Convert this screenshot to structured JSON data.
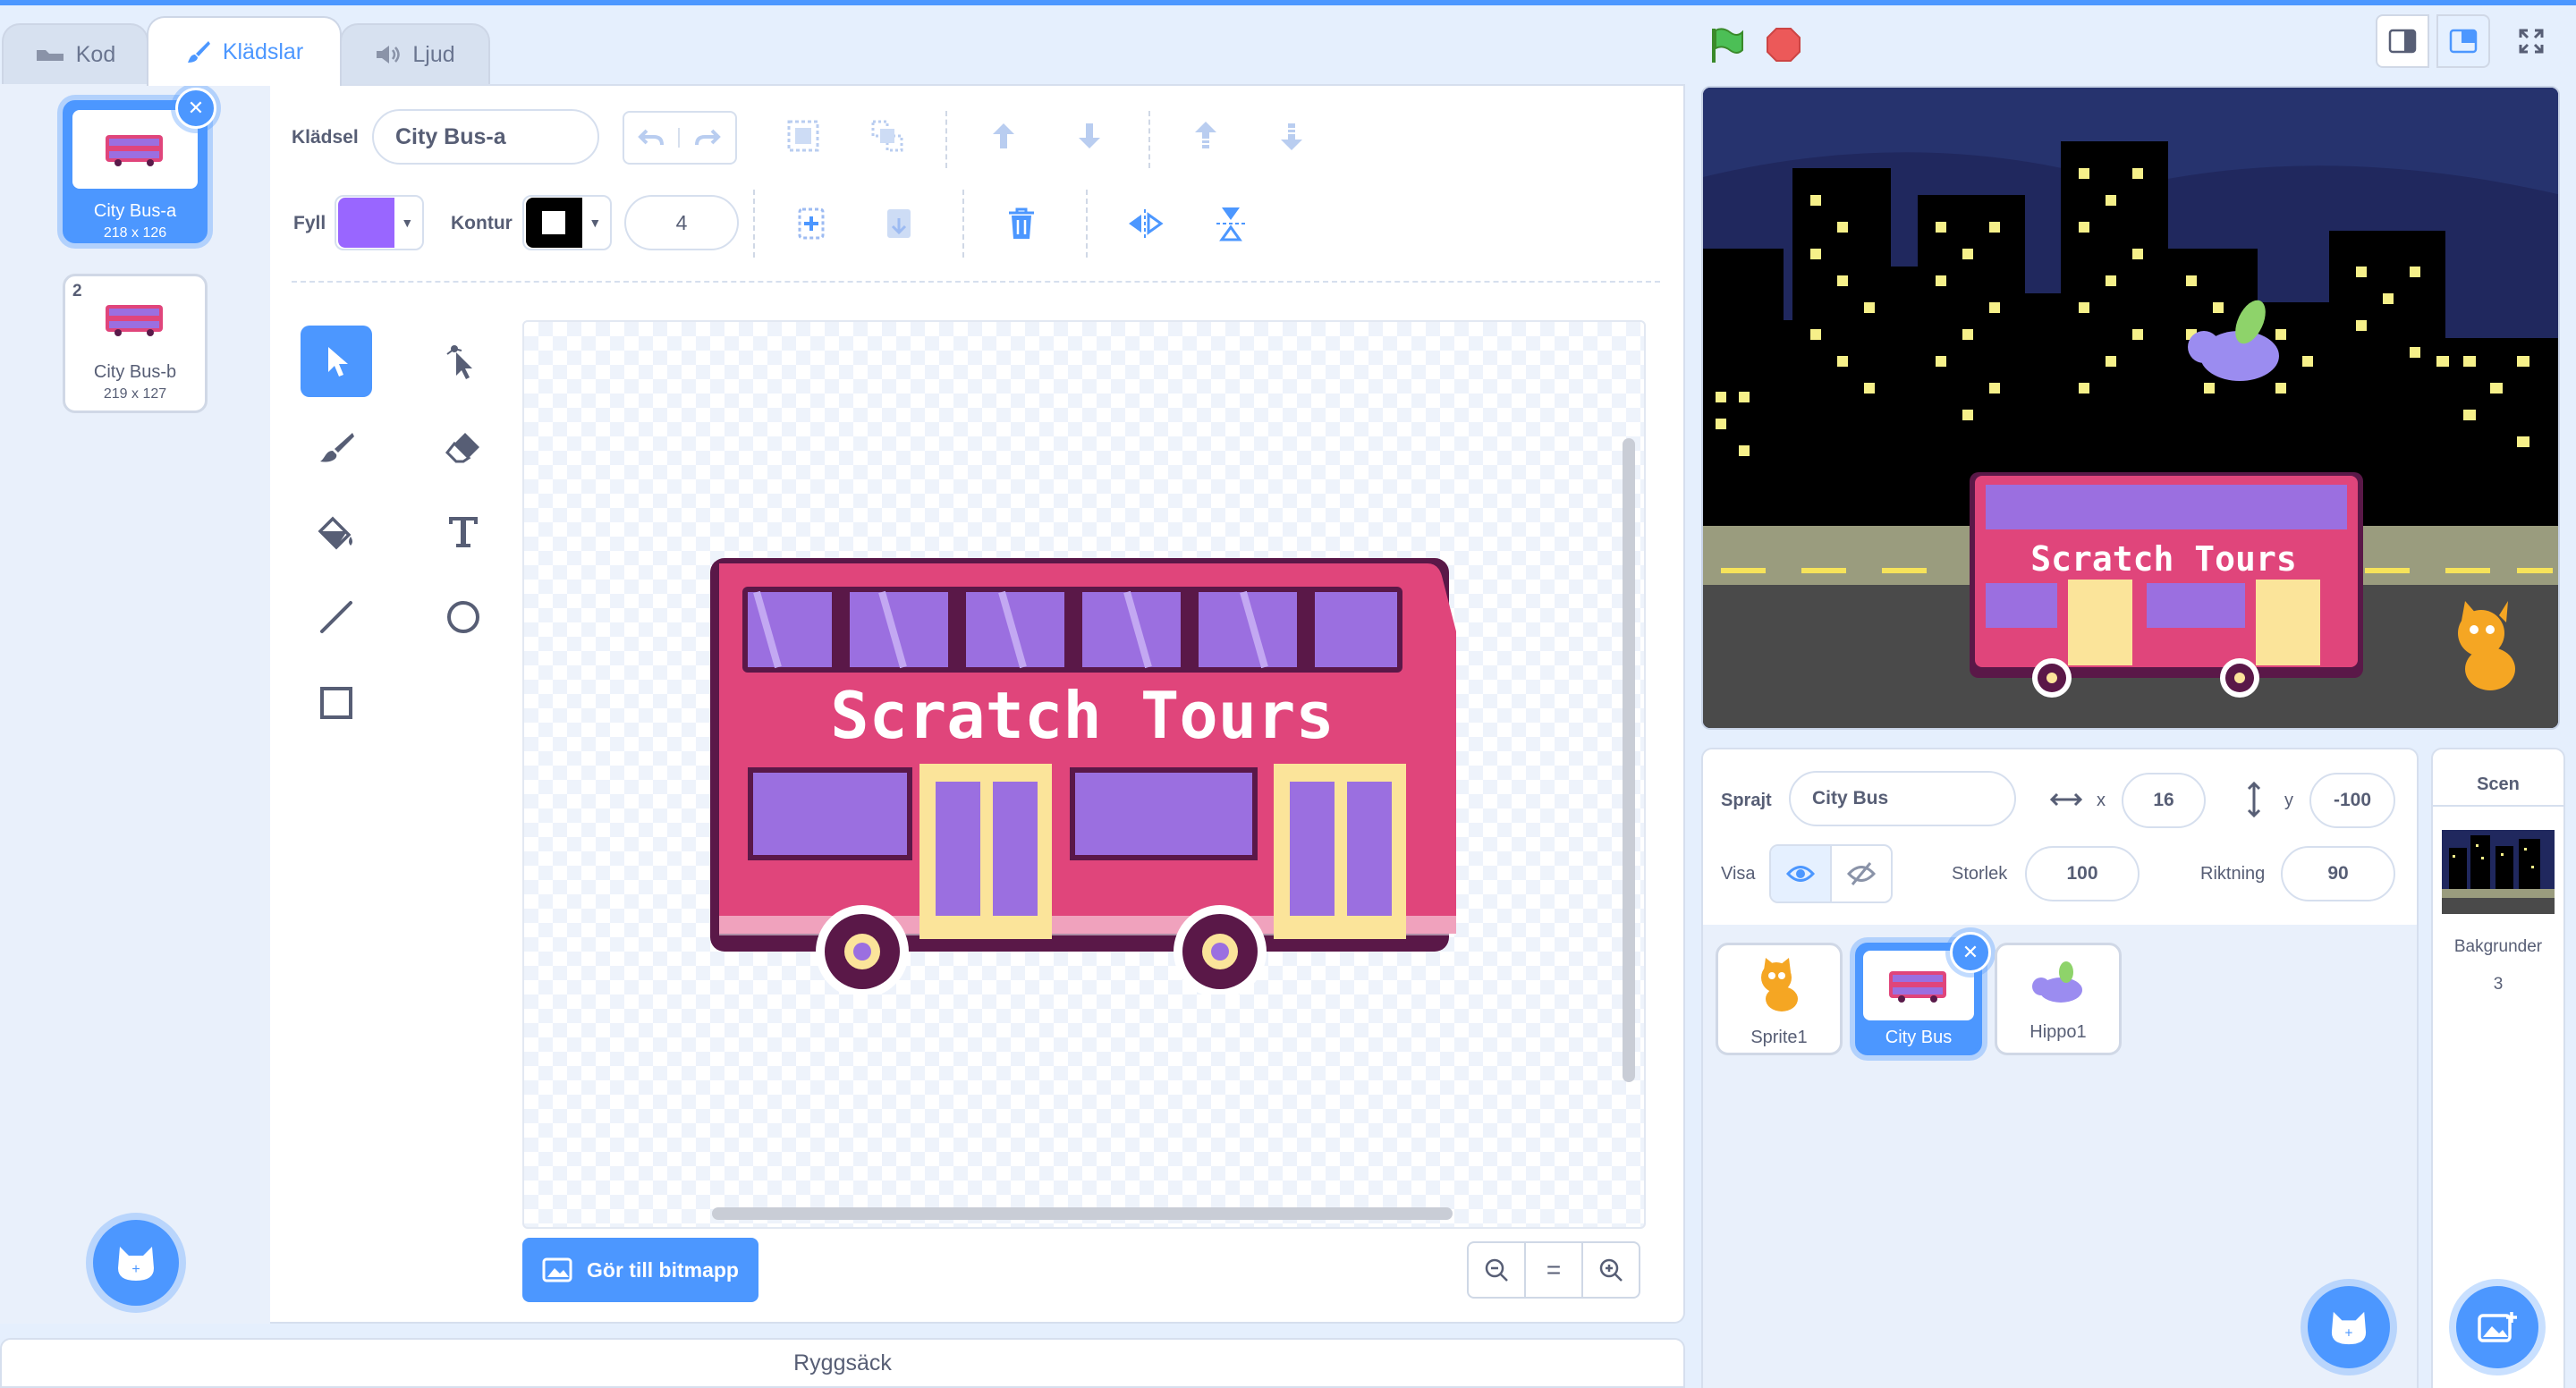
{
  "tabs": [
    {
      "label": "Kod",
      "icon": "code-icon"
    },
    {
      "label": "Klädslar",
      "icon": "paintbrush-icon"
    },
    {
      "label": "Ljud",
      "icon": "speaker-icon"
    }
  ],
  "costumes": [
    {
      "number": "1",
      "name": "City Bus-a",
      "size": "218 x 126"
    },
    {
      "number": "2",
      "name": "City Bus-b",
      "size": "219 x 127"
    }
  ],
  "editor": {
    "costume_label": "Klädsel",
    "costume_name": "City Bus-a",
    "fill_label": "Fyll",
    "fill_color": "#9966ff",
    "outline_label": "Kontur",
    "outline_color": "#000000",
    "outline_width": "4",
    "bitmap_button": "Gör till bitmapp",
    "zoom_reset": "="
  },
  "drawing": {
    "bus_text": "Scratch Tours",
    "bus_color": "#e0457b",
    "window_color": "#9b6fe0"
  },
  "stage": {
    "bus_text": "Scratch Tours"
  },
  "sprite_info": {
    "sprite_label": "Sprajt",
    "sprite_name": "City Bus",
    "x_label": "x",
    "x_value": "16",
    "y_label": "y",
    "y_value": "-100",
    "show_label": "Visa",
    "size_label": "Storlek",
    "size_value": "100",
    "direction_label": "Riktning",
    "direction_value": "90"
  },
  "sprites": [
    {
      "name": "Sprite1"
    },
    {
      "name": "City Bus"
    },
    {
      "name": "Hippo1"
    }
  ],
  "scene": {
    "title": "Scen",
    "backdrops_label": "Bakgrunder",
    "backdrops_count": "3"
  },
  "backpack": "Ryggsäck"
}
